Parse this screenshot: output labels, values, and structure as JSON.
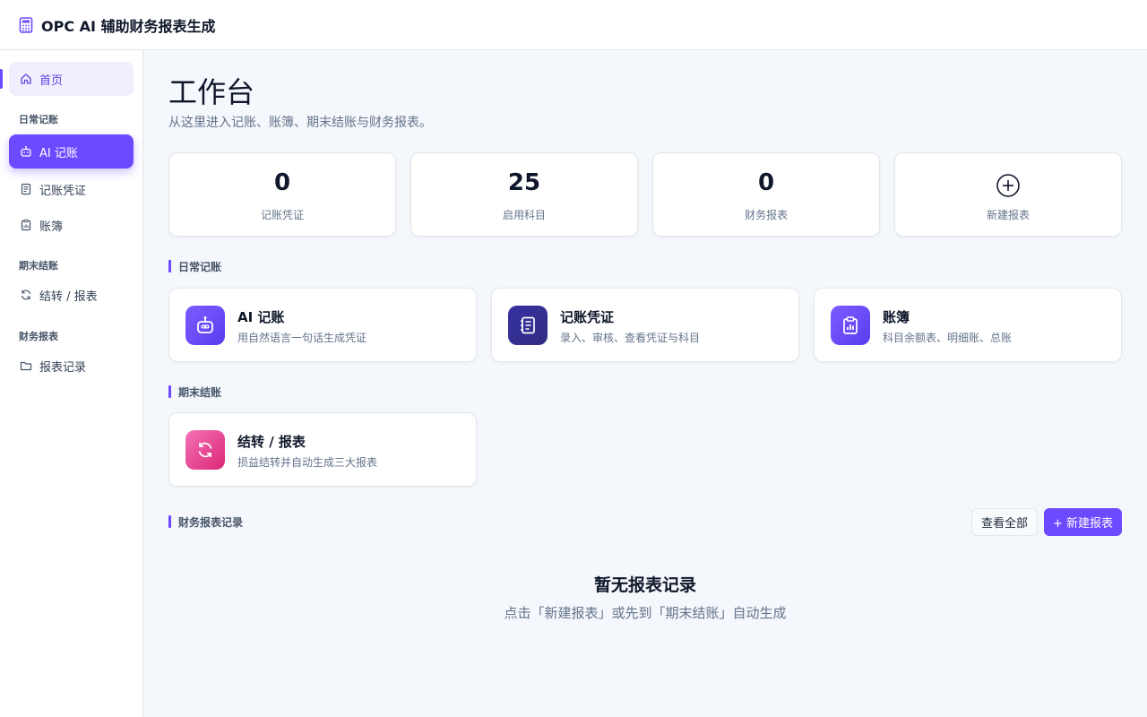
{
  "app": {
    "title": "OPC AI 辅助财务报表生成",
    "icon": "calculator-icon",
    "accent": "#6d4aff"
  },
  "sidebar": {
    "home": {
      "label": "首页",
      "icon": "home-icon"
    },
    "sections": [
      {
        "title": "日常记账"
      },
      {
        "title": "期末结账"
      },
      {
        "title": "财务报表"
      }
    ],
    "items": [
      {
        "label": "AI 记账",
        "icon": "robot-icon"
      },
      {
        "label": "记账凭证",
        "icon": "document-icon"
      },
      {
        "label": "账簿",
        "icon": "ledger-icon"
      },
      {
        "label": "结转 / 报表",
        "icon": "refresh-icon"
      },
      {
        "label": "报表记录",
        "icon": "folder-icon"
      }
    ]
  },
  "main": {
    "title": "工作台",
    "subtitle": "从这里进入记账、账簿、期末结账与财务报表。",
    "stats": [
      {
        "value": "0",
        "label": "记账凭证"
      },
      {
        "value": "25",
        "label": "启用科目"
      },
      {
        "value": "0",
        "label": "财务报表"
      },
      {
        "label": "新建报表",
        "icon": "plus-circle-icon"
      }
    ],
    "sections": {
      "daily": "日常记账",
      "period_end": "期末结账",
      "reports": "财务报表记录"
    },
    "features": [
      {
        "title": "AI 记账",
        "desc": "用自然语言一句话生成凭证",
        "icon": "robot-icon",
        "color": "#6d4aff"
      },
      {
        "title": "记账凭证",
        "desc": "录入、审核、查看凭证与科目",
        "icon": "notebook-icon",
        "color": "#3730a3"
      },
      {
        "title": "账簿",
        "desc": "科目余额表、明细账、总账",
        "icon": "clipboard-chart-icon",
        "color": "#6d4aff"
      },
      {
        "title": "结转 / 报表",
        "desc": "损益结转并自动生成三大报表",
        "icon": "refresh-icon",
        "color": "#ec4899"
      }
    ],
    "buttons": {
      "view_all": "查看全部",
      "new_report": "+ 新建报表"
    },
    "empty": {
      "title": "暂无报表记录",
      "subtitle": "点击「新建报表」或先到「期末结账」自动生成"
    }
  }
}
